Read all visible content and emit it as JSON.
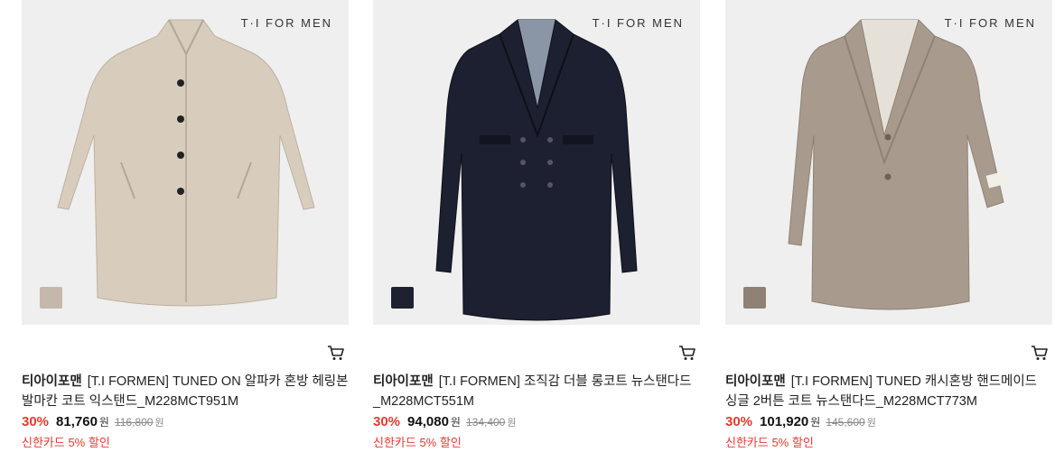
{
  "products": [
    {
      "brand_mark": "T·I FOR MEN",
      "swatch_color": "#c4b8aa",
      "coat_color": "#d8cdbd",
      "brand": "티아이포맨",
      "name": "[T.I FORMEN] TUNED ON 알파카 혼방 헤링본 발마칸 코트 익스탠드_M228MCT951M",
      "discount": "30%",
      "price": "81,760",
      "price_unit": "원",
      "original_price": "116,800",
      "original_unit": "원",
      "card_offer": "신한카드 5% 할인",
      "cart_icon": "cart-icon"
    },
    {
      "brand_mark": "T·I FOR MEN",
      "swatch_color": "#1e2230",
      "coat_color": "#1c2030",
      "brand": "티아이포맨",
      "name": "[T.I FORMEN] 조직감 더블 롱코트 뉴스탠다드_M228MCT551M",
      "discount": "30%",
      "price": "94,080",
      "price_unit": "원",
      "original_price": "134,400",
      "original_unit": "원",
      "card_offer": "신한카드 5% 할인",
      "cart_icon": "cart-icon"
    },
    {
      "brand_mark": "T·I FOR MEN",
      "swatch_color": "#8f8275",
      "coat_color": "#a89b8e",
      "brand": "티아이포맨",
      "name": "[T.I FORMEN] TUNED 캐시혼방 핸드메이드 싱글 2버튼 코트 뉴스탠다드_M228MCT773M",
      "discount": "30%",
      "price": "101,920",
      "price_unit": "원",
      "original_price": "145,600",
      "original_unit": "원",
      "card_offer": "신한카드 5% 할인",
      "cart_icon": "cart-icon"
    }
  ],
  "colors": {
    "accent_red": "#e83a2f",
    "thumb_bg": "#efefef"
  }
}
